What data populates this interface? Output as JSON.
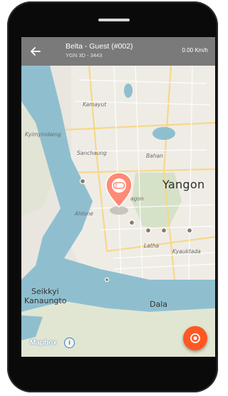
{
  "header": {
    "title": "Belta - Guest (#002)",
    "subtitle": "YGN 3D - 3443",
    "speed": "0.00 Km/h"
  },
  "map": {
    "labels": {
      "kamayut": "Kamayut",
      "kyimyindaing": "Kyimyindaing",
      "sanchaung": "Sanchaung",
      "bahan": "Bahan",
      "yangon": "Yangon",
      "ahlone": "Ahlone",
      "agon": "agon",
      "latha": "Latha",
      "kyauktada": "Kyauktada",
      "seikkyi": "Seikkyi",
      "kanaungto": "Kanaungto",
      "dala": "Dala"
    },
    "attribution": "Mapbox",
    "info_symbol": "i"
  },
  "colors": {
    "appbar": "#7a7a7a",
    "accent": "#ff5722",
    "water": "#8fbfcf",
    "park": "#cfe0c0"
  },
  "icons": {
    "back": "arrow-left-icon",
    "marker": "car-marker-icon",
    "locate": "my-location-icon"
  }
}
